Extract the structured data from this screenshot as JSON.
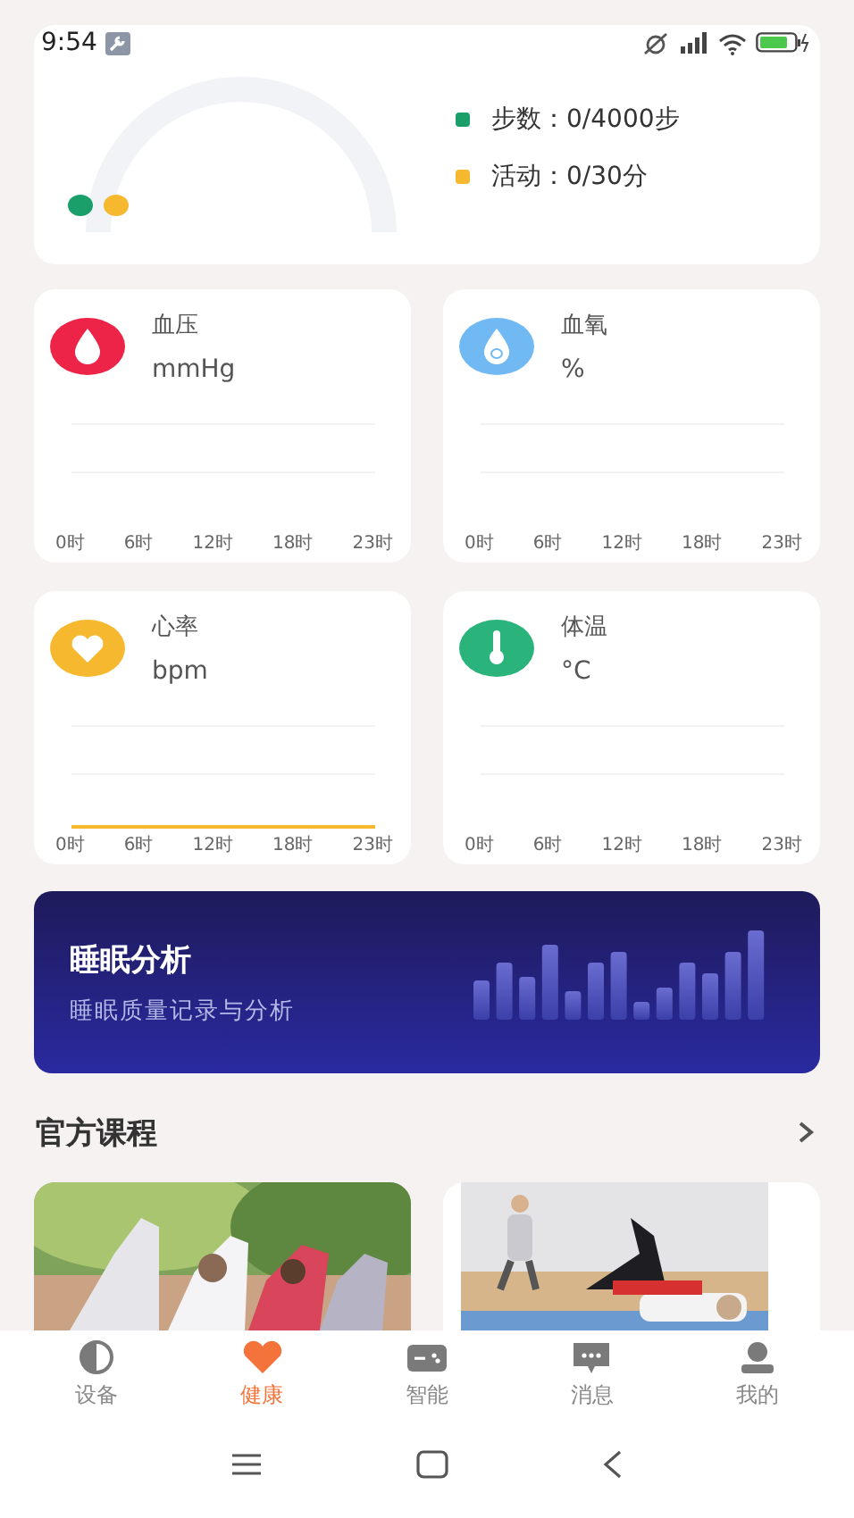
{
  "status_bar": {
    "time": "9:54"
  },
  "activity": {
    "items": [
      {
        "label": "步数：0/4000步",
        "color": "#1a9e6a"
      },
      {
        "label": "活动：0/30分",
        "color": "#f5b82e"
      }
    ]
  },
  "metrics": [
    {
      "title": "血压",
      "unit": "mmHg",
      "kind": "drop",
      "color": "#ee2348",
      "baseline": false,
      "x_labels": [
        "0时",
        "6时",
        "12时",
        "18时",
        "23时"
      ]
    },
    {
      "title": "血氧",
      "unit": "%",
      "kind": "oxygen",
      "color": "#71b9f3",
      "baseline": false,
      "x_labels": [
        "0时",
        "6时",
        "12时",
        "18时",
        "23时"
      ]
    },
    {
      "title": "心率",
      "unit": "bpm",
      "kind": "heart",
      "color": "#f5b82e",
      "baseline": true,
      "x_labels": [
        "0时",
        "6时",
        "12时",
        "18时",
        "23时"
      ]
    },
    {
      "title": "体温",
      "unit": "°C",
      "kind": "thermometer",
      "color": "#2ab37a",
      "baseline": false,
      "x_labels": [
        "0时",
        "6时",
        "12时",
        "18时",
        "23时"
      ]
    }
  ],
  "sleep_banner": {
    "title": "睡眠分析",
    "subtitle": "睡眠质量记录与分析"
  },
  "courses": {
    "heading": "官方课程"
  },
  "bottom_nav": [
    {
      "label": "设备",
      "kind": "device",
      "selected": false
    },
    {
      "label": "健康",
      "kind": "heart",
      "selected": true
    },
    {
      "label": "智能",
      "kind": "gamepad",
      "selected": false
    },
    {
      "label": "消息",
      "kind": "chat",
      "selected": false
    },
    {
      "label": "我的",
      "kind": "person",
      "selected": false
    }
  ]
}
